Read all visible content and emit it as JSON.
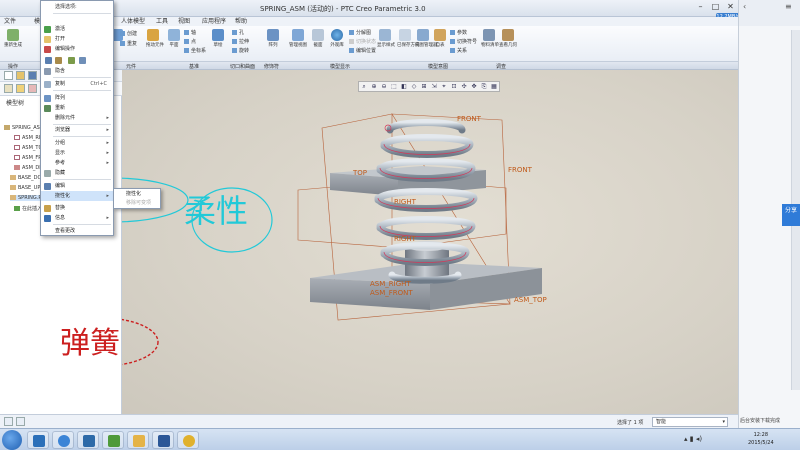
{
  "window": {
    "title": "SPRING_ASM (活动的) - PTC Creo Parametric 3.0",
    "controls": {
      "minimize": "–",
      "maximize": "□",
      "close": "✕"
    },
    "net_speed": "12.2MB/s"
  },
  "menu_tabs": [
    "文件",
    "模",
    "人体模型",
    "工具",
    "视图",
    "应用程序",
    "帮助"
  ],
  "ribbon": {
    "big_buttons": [
      {
        "label": "重新生成",
        "icon": "regenerate-icon"
      },
      {
        "label": "组装",
        "icon": "assemble-icon"
      },
      {
        "label": "创建",
        "icon": "create-icon"
      },
      {
        "label": "重复",
        "icon": "repeat-icon"
      },
      {
        "label": "拖动元件",
        "icon": "drag-icon"
      },
      {
        "label": "平面",
        "icon": "plane-icon"
      },
      {
        "label": "草绘",
        "icon": "sketch-icon"
      },
      {
        "label": "阵列",
        "icon": "pattern-icon"
      },
      {
        "label": "管理视图",
        "icon": "manage-views-icon"
      },
      {
        "label": "截面",
        "icon": "section-icon"
      },
      {
        "label": "外观库",
        "icon": "appearance-icon"
      },
      {
        "label": "显示样式",
        "icon": "display-style-icon"
      },
      {
        "label": "已保存方向",
        "icon": "saved-orientation-icon"
      },
      {
        "label": "视图管理器",
        "icon": "view-manager-icon"
      },
      {
        "label": "自表",
        "icon": "table-icon"
      },
      {
        "label": "物料清单",
        "icon": "bom-icon"
      },
      {
        "label": "查看几何",
        "icon": "geometry-icon"
      }
    ],
    "small_buttons": {
      "datum": [
        "轴",
        "点",
        "坐标系"
      ],
      "cut_surface": [
        "孔",
        "拉伸",
        "旋转"
      ],
      "model_display": [
        "分解图",
        "切换状态",
        "编辑位置"
      ],
      "model_intent": [
        "参数",
        "切换符号",
        "关系"
      ]
    },
    "group_labels": [
      "操作",
      "元件",
      "基准",
      "切口和曲面",
      "修饰符",
      "模型显示",
      "模型意图",
      "调查"
    ]
  },
  "left_panel": {
    "title": "模型树",
    "tree": [
      {
        "label": "SPRING_ASM.ASM",
        "icon": "assembly-icon"
      },
      {
        "label": "ASM_RIGHT",
        "icon": "datum-plane-icon"
      },
      {
        "label": "ASM_TOP",
        "icon": "datum-plane-icon"
      },
      {
        "label": "ASM_FRONT",
        "icon": "datum-plane-icon"
      },
      {
        "label": "ASM_DEF_CSYS",
        "icon": "csys-icon"
      },
      {
        "label": "BASE_DOWN.PRT",
        "icon": "part-icon"
      },
      {
        "label": "BASE_UP.PRT",
        "icon": "part-icon"
      },
      {
        "label": "SPRING.PRT",
        "icon": "part-icon"
      },
      {
        "label": "在此插入",
        "icon": "insert-here-icon"
      }
    ]
  },
  "context_menu": {
    "header": "选择选项:",
    "items": [
      {
        "label": "激活",
        "shortcut": "",
        "submenu": false
      },
      {
        "label": "打开",
        "shortcut": "",
        "submenu": false
      },
      {
        "label": "编辑操作",
        "shortcut": "",
        "submenu": false
      },
      {
        "label": "隐含",
        "shortcut": "",
        "submenu": false
      },
      {
        "label": "复制",
        "shortcut": "Ctrl+C",
        "submenu": false
      },
      {
        "label": "阵列",
        "shortcut": "",
        "submenu": false
      },
      {
        "label": "重新",
        "shortcut": "",
        "submenu": false
      },
      {
        "label": "删除元件",
        "shortcut": "",
        "submenu": true
      },
      {
        "label": "浏览器",
        "shortcut": "",
        "submenu": true
      },
      {
        "label": "分组",
        "shortcut": "",
        "submenu": true
      },
      {
        "label": "显示",
        "shortcut": "",
        "submenu": true
      },
      {
        "label": "参考",
        "shortcut": "",
        "submenu": true
      },
      {
        "label": "隐藏",
        "shortcut": "",
        "submenu": false
      },
      {
        "label": "编辑",
        "shortcut": "",
        "submenu": false
      },
      {
        "label": "挠性化",
        "shortcut": "",
        "submenu": true,
        "highlighted": true
      },
      {
        "label": "替换",
        "shortcut": "",
        "submenu": false
      },
      {
        "label": "信息",
        "shortcut": "",
        "submenu": true
      },
      {
        "label": "查看更改",
        "shortcut": "",
        "submenu": false
      }
    ],
    "submenu_items": [
      {
        "label": "挠性化",
        "disabled": false
      },
      {
        "label": "移除可变项",
        "disabled": true
      }
    ]
  },
  "graphics": {
    "view_toolbar": [
      "⌕",
      "⊕",
      "⊖",
      "⬚",
      "◧",
      "◇",
      "⊞",
      "⇲",
      "⌖",
      "⊡",
      "✣",
      "✥",
      "⎘",
      "▦"
    ],
    "annotations": {
      "front_top": "FRONT",
      "front_right": "FRONT",
      "top_left": "TOP",
      "right_1": "RIGHT",
      "right_2": "RIGHT",
      "asm_right": "ASM_RIGHT",
      "asm_front": "ASM_FRONT",
      "asm_top": "ASM_TOP"
    },
    "handwriting": {
      "top": "柔性",
      "bottom": "弹簧"
    }
  },
  "status_bar": {
    "selected": "选择了 1 项",
    "filter": "智能"
  },
  "side_panel": {
    "share": "分享",
    "notice": "后台安装下载完成"
  },
  "taskbar": {
    "apps": [
      {
        "name": "explorer",
        "icon": "explorer-icon",
        "color": "#2a6fb9"
      },
      {
        "name": "ie",
        "icon": "ie-icon",
        "color": "#3b84d6"
      },
      {
        "name": "connect",
        "icon": "link-icon",
        "color": "#2d6aa8"
      },
      {
        "name": "creo",
        "icon": "creo-icon",
        "color": "#4f9a3a"
      },
      {
        "name": "folder",
        "icon": "folder-icon",
        "color": "#e4b347"
      },
      {
        "name": "word",
        "icon": "word-icon",
        "color": "#2b5797"
      },
      {
        "name": "wechat",
        "icon": "chat-icon",
        "color": "#e0b12c"
      }
    ],
    "clock": {
      "time": "12:28",
      "date": "2015/5/24"
    }
  },
  "colors": {
    "accent": "#2f7bd8",
    "annotation": "#c05a1a",
    "ink_red": "#cc1f1f",
    "ink_cyan": "#22c9d8",
    "spring": "#9aa8b8"
  }
}
